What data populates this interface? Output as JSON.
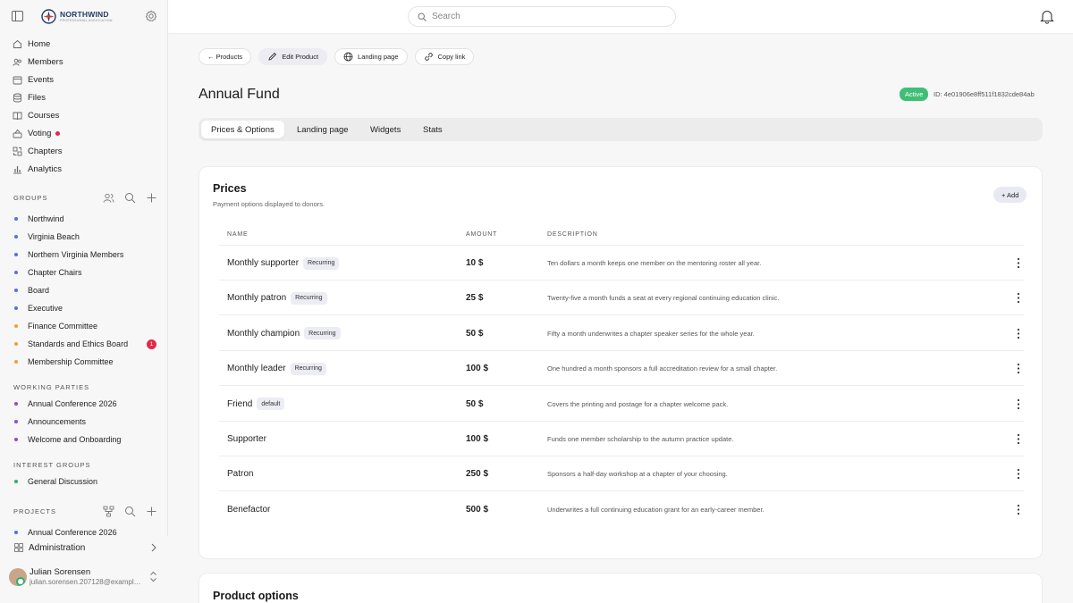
{
  "brand": {
    "name": "NORTHWIND",
    "sub": "PROFESSIONAL ASSOCIATION",
    "color": "#233a66"
  },
  "search": {
    "placeholder": "Search"
  },
  "nav": [
    {
      "label": "Home",
      "icon": "home-icon"
    },
    {
      "label": "Members",
      "icon": "members-icon"
    },
    {
      "label": "Events",
      "icon": "calendar-icon"
    },
    {
      "label": "Files",
      "icon": "database-icon"
    },
    {
      "label": "Courses",
      "icon": "book-icon"
    },
    {
      "label": "Voting",
      "icon": "voting-icon",
      "notification": true
    },
    {
      "label": "Chapters",
      "icon": "chapters-icon"
    },
    {
      "label": "Analytics",
      "icon": "analytics-icon"
    }
  ],
  "groups": {
    "label": "GROUPS",
    "items": [
      {
        "label": "Northwind",
        "color": "#5b6fd6"
      },
      {
        "label": "Virginia Beach",
        "color": "#5b6fd6"
      },
      {
        "label": "Northern Virginia Members",
        "color": "#5b6fd6"
      },
      {
        "label": "Chapter Chairs",
        "color": "#5b6fd6"
      },
      {
        "label": "Board",
        "color": "#5b6fd6"
      },
      {
        "label": "Executive",
        "color": "#5b6fd6"
      },
      {
        "label": "Finance Committee",
        "color": "#e8a23a"
      },
      {
        "label": "Standards and Ethics Board",
        "color": "#e8a23a",
        "badge": "1"
      },
      {
        "label": "Membership Committee",
        "color": "#e8a23a"
      }
    ]
  },
  "working_parties": {
    "label": "WORKING PARTIES",
    "items": [
      {
        "label": "Annual Conference 2026",
        "color": "#8a4fc9"
      },
      {
        "label": "Announcements",
        "color": "#8a4fc9"
      },
      {
        "label": "Welcome and Onboarding",
        "color": "#8a4fc9"
      }
    ]
  },
  "interest_groups": {
    "label": "INTEREST GROUPS",
    "items": [
      {
        "label": "General Discussion",
        "color": "#2fae6b"
      }
    ]
  },
  "projects": {
    "label": "PROJECTS",
    "partial_item": "Annual Conference 2026"
  },
  "admin": {
    "label": "Administration"
  },
  "user": {
    "name": "Julian Sorensen",
    "email": "julian.sorensen.207128@example.com",
    "status_color": "#2fae6b"
  },
  "actions": {
    "back": "← Products",
    "edit": "Edit Product",
    "landing": "Landing page",
    "copy": "Copy link"
  },
  "product": {
    "title": "Annual Fund",
    "status": "Active",
    "status_color": "#3fbf75",
    "id": "ID: 4e01906e8ff511f1832cde84ab"
  },
  "tabs": [
    "Prices & Options",
    "Landing page",
    "Widgets",
    "Stats"
  ],
  "prices": {
    "title": "Prices",
    "subtitle": "Payment options displayed to donors.",
    "add_label": "+ Add",
    "columns": {
      "name": "NAME",
      "amount": "AMOUNT",
      "description": "DESCRIPTION"
    },
    "rows": [
      {
        "name": "Monthly supporter",
        "tag": "Recurring",
        "amount": "10 $",
        "description": "Ten dollars a month keeps one member on the mentoring roster all year."
      },
      {
        "name": "Monthly patron",
        "tag": "Recurring",
        "amount": "25 $",
        "description": "Twenty-five a month funds a seat at every regional continuing education clinic."
      },
      {
        "name": "Monthly champion",
        "tag": "Recurring",
        "amount": "50 $",
        "description": "Fifty a month underwrites a chapter speaker series for the whole year."
      },
      {
        "name": "Monthly leader",
        "tag": "Recurring",
        "amount": "100 $",
        "description": "One hundred a month sponsors a full accreditation review for a small chapter."
      },
      {
        "name": "Friend",
        "tag": "default",
        "amount": "50 $",
        "description": "Covers the printing and postage for a chapter welcome pack."
      },
      {
        "name": "Supporter",
        "tag": "",
        "amount": "100 $",
        "description": "Funds one member scholarship to the autumn practice update."
      },
      {
        "name": "Patron",
        "tag": "",
        "amount": "250 $",
        "description": "Sponsors a half-day workshop at a chapter of your choosing."
      },
      {
        "name": "Benefactor",
        "tag": "",
        "amount": "500 $",
        "description": "Underwrites a full continuing education grant for an early-career member."
      }
    ]
  },
  "options": {
    "title": "Product options"
  }
}
